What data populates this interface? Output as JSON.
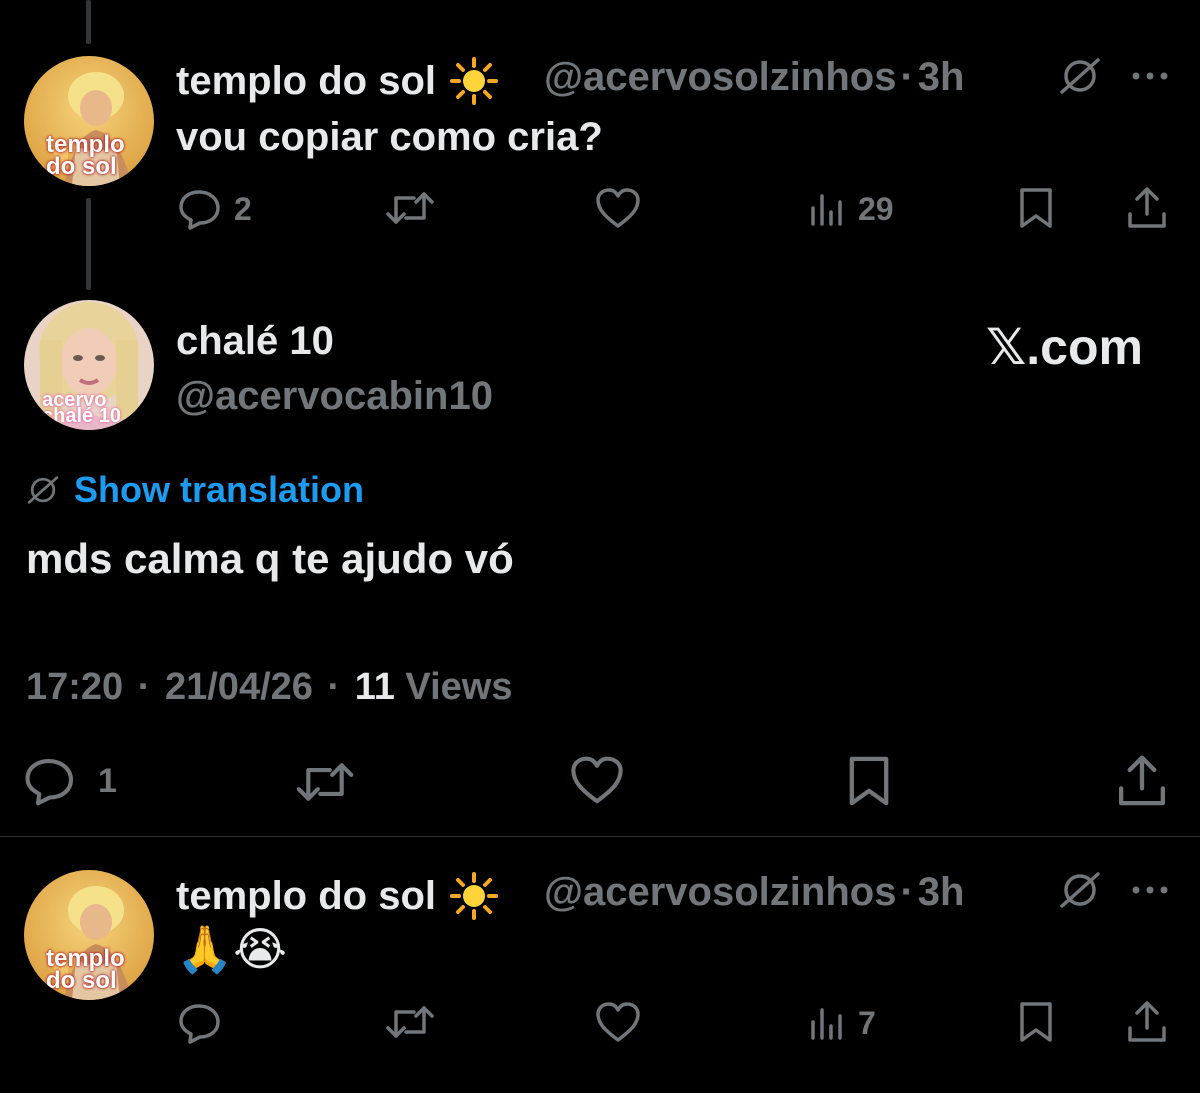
{
  "reply1": {
    "display_name": "templo do sol",
    "name_emoji": "☀️",
    "handle": "@acervosolzinhos",
    "separator": "·",
    "time": "3h",
    "text": "vou copiar como cria?",
    "avatar_text_line1": "templo",
    "avatar_text_line2": "do sol",
    "replies": "2",
    "retweets": "",
    "likes": "",
    "views": "29",
    "translate_icon": "translate-globe-icon",
    "more_icon": "more-dots-icon"
  },
  "main": {
    "display_name": "chalé 10",
    "handle": "@acervocabin10",
    "avatar_text_line1": "acervo",
    "avatar_text_line2": "chalé 10",
    "brand": "𝕏.com",
    "show_translation": "Show translation",
    "text": "mds calma q te ajudo vó",
    "time": "17:20",
    "date": "21/04/26",
    "sep": "·",
    "views_count": "11",
    "views_label": "Views",
    "replies": "1"
  },
  "reply2": {
    "display_name": "templo do sol",
    "name_emoji": "☀️",
    "handle": "@acervosolzinhos",
    "separator": "·",
    "time": "3h",
    "text": "🙏😭",
    "avatar_text_line1": "templo",
    "avatar_text_line2": "do sol",
    "replies": "",
    "views": "7"
  },
  "colors": {
    "background": "#000000",
    "text_primary": "#e7e9ea",
    "text_muted": "#71767b",
    "link": "#1d9bf0",
    "divider": "#2f3336"
  }
}
